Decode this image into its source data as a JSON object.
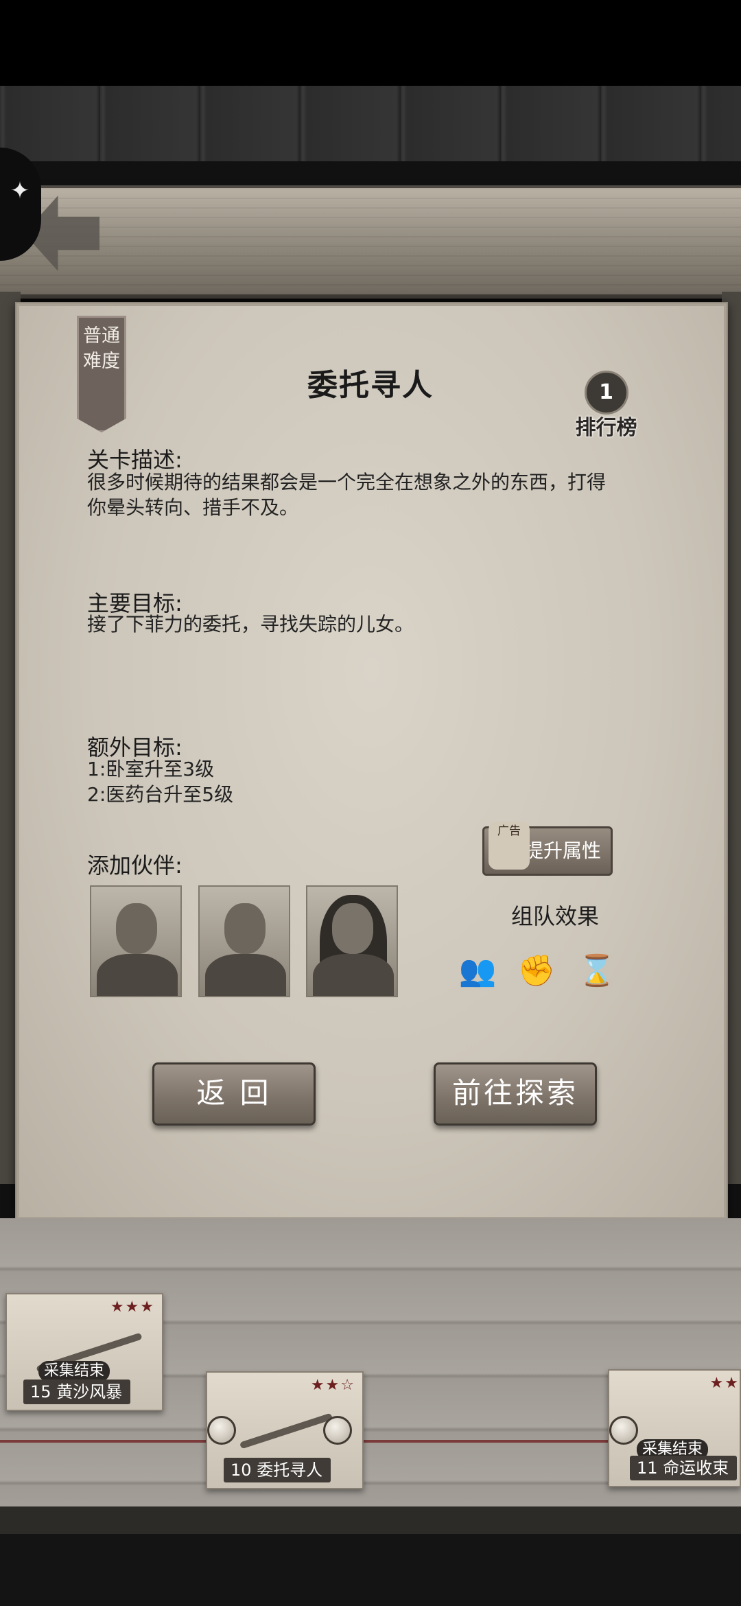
{
  "difficulty": "普通难度",
  "title": "委托寻人",
  "leaderboard": {
    "rank": "1",
    "label": "排行榜"
  },
  "description": {
    "heading": "关卡描述:",
    "line1": "很多时候期待的结果都会是一个完全在想象之外的东西，打得",
    "line2": "你晕头转向、措手不及。"
  },
  "main_goal": {
    "heading": "主要目标:",
    "text": "接了下菲力的委托，寻找失踪的儿女。"
  },
  "extra_goal": {
    "heading": "额外目标:",
    "item1": "1:卧室升至3级",
    "item2": "2:医药台升至5级"
  },
  "partners": {
    "heading": "添加伙伴:"
  },
  "boost": {
    "ad_badge": "广告",
    "label": "提升属性"
  },
  "team_effect": {
    "title": "组队效果",
    "icons": [
      "people-icon",
      "fist-icon",
      "hourglass-icon"
    ]
  },
  "buttons": {
    "back": "返 回",
    "explore": "前往探索"
  },
  "level_cards": [
    {
      "stars": "★★★",
      "tag": "采集结束",
      "number": "15",
      "name": "黄沙风暴"
    },
    {
      "stars": "★★☆",
      "number": "10",
      "name": "委托寻人"
    },
    {
      "stars": "★★",
      "tag": "采集结束",
      "number": "11",
      "name": "命运收束"
    }
  ],
  "colors": {
    "panel": "#d9d3c8",
    "button": "#7c7268",
    "star": "#6c1f1f"
  }
}
